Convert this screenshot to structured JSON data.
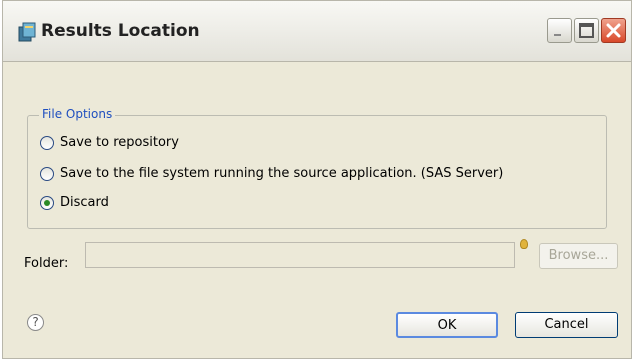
{
  "window": {
    "title": "Results Location",
    "title_icon": "app-window-icon",
    "controls": {
      "minimize_icon": "minimize-icon",
      "maximize_icon": "maximize-icon",
      "close_icon": "close-icon"
    }
  },
  "file_options": {
    "legend": "File Options",
    "options": [
      {
        "label": "Save to repository",
        "checked": false
      },
      {
        "label": "Save to the file system running the source application. (SAS Server)",
        "checked": false
      },
      {
        "label": "Discard",
        "checked": true
      }
    ]
  },
  "folder": {
    "label": "Folder:",
    "value": "",
    "disabled": true,
    "hint_icon": "lightbulb-icon",
    "browse_label": "Browse..."
  },
  "footer": {
    "help_icon": "help-icon",
    "help_glyph": "?",
    "ok_label": "OK",
    "cancel_label": "Cancel"
  },
  "colors": {
    "dialog_bg": "#ece9d8",
    "legend_text": "#1f4fbf",
    "close_button": "#d9482a",
    "default_button_border": "#5b8ae0"
  }
}
